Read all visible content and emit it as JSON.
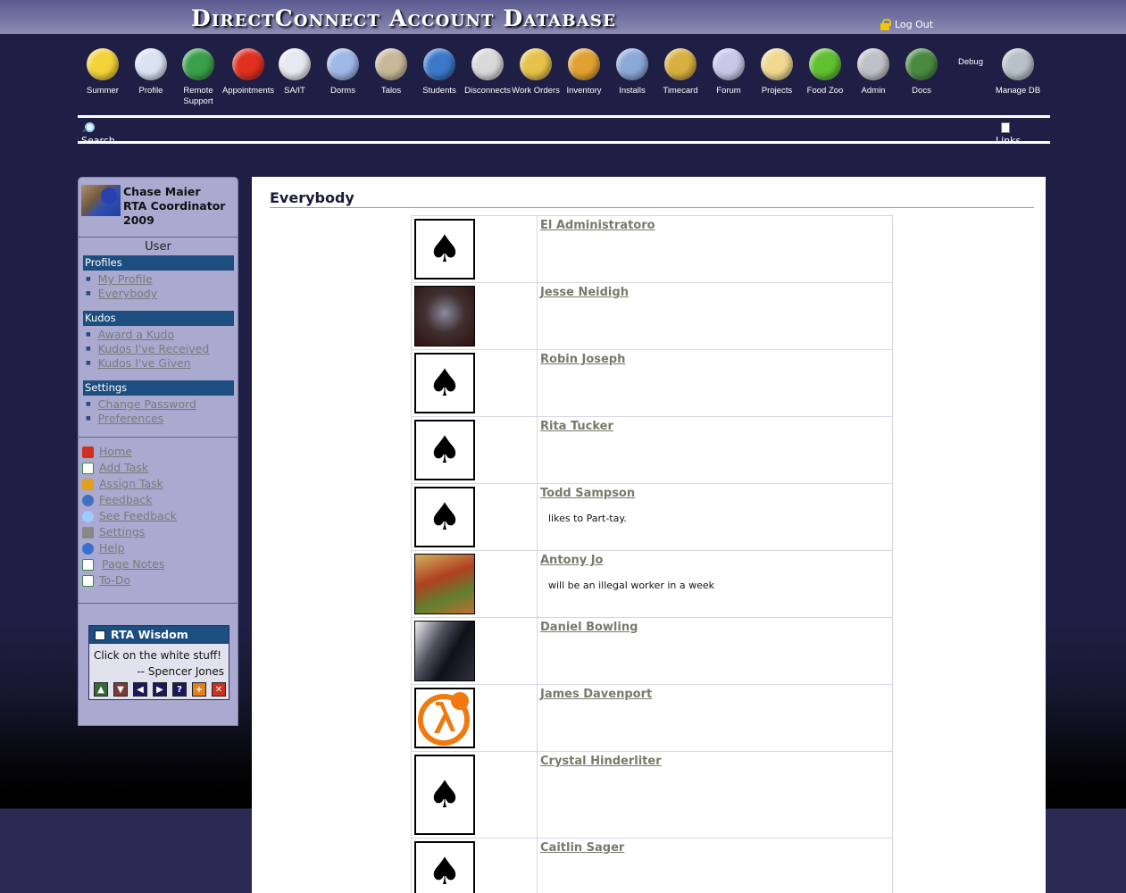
{
  "header": {
    "title": "DirectConnect Account Database",
    "logout_label": "Log Out"
  },
  "nav": [
    {
      "label": "Summer",
      "icon": "sunglasses-face-icon",
      "color": "#f4d23a"
    },
    {
      "label": "Profile",
      "icon": "profile-card-icon",
      "color": "#d9e3f2"
    },
    {
      "label": "Remote Support",
      "icon": "globe-question-icon",
      "color": "#3aa04a"
    },
    {
      "label": "Appointments",
      "icon": "alarm-clock-icon",
      "color": "#e03020"
    },
    {
      "label": "SA/IT",
      "icon": "medical-cross-icon",
      "color": "#e8e8f0"
    },
    {
      "label": "Dorms",
      "icon": "building-icon",
      "color": "#9fb8e6"
    },
    {
      "label": "Talos",
      "icon": "skull-icon",
      "color": "#c8b89a"
    },
    {
      "label": "Students",
      "icon": "student-person-icon",
      "color": "#3b78c8"
    },
    {
      "label": "Disconnects",
      "icon": "unplugged-cable-icon",
      "color": "#d9d9d9"
    },
    {
      "label": "Work Orders",
      "icon": "clipboard-pin-icon",
      "color": "#e6c24a"
    },
    {
      "label": "Inventory",
      "icon": "box-icon",
      "color": "#e2a232"
    },
    {
      "label": "Installs",
      "icon": "install-disc-icon",
      "color": "#8aa8d8"
    },
    {
      "label": "Timecard",
      "icon": "money-bag-icon",
      "color": "#d8b040"
    },
    {
      "label": "Forum",
      "icon": "speech-bubble-icon",
      "color": "#c8c8e8"
    },
    {
      "label": "Projects",
      "icon": "folder-icon",
      "color": "#f0d890"
    },
    {
      "label": "Food Zoo",
      "icon": "apple-icon",
      "color": "#60c030"
    },
    {
      "label": "Admin",
      "icon": "gears-icon",
      "color": "#c0c0c8"
    },
    {
      "label": "Docs",
      "icon": "books-icon",
      "color": "#4a8a40"
    },
    {
      "label": "Debug",
      "icon": "",
      "color": ""
    },
    {
      "label": "Manage DB",
      "icon": "database-check-icon",
      "color": "#b8c0c8"
    }
  ],
  "subnav": {
    "search_label": "Search",
    "links_label": "Links"
  },
  "sidebar": {
    "profile": {
      "line1": "Chase Maier",
      "line2": "RTA Coordinator",
      "line3": "2009"
    },
    "heading": "User",
    "sections": [
      {
        "title": "Profiles",
        "items": [
          "My Profile",
          "Everybody"
        ]
      },
      {
        "title": "Kudos",
        "items": [
          "Award a Kudo",
          "Kudos I've Received",
          "Kudos I've Given"
        ]
      },
      {
        "title": "Settings",
        "items": [
          "Change Password",
          "Preferences"
        ]
      }
    ],
    "actions": [
      {
        "label": "Home",
        "icon": "home-icon"
      },
      {
        "label": "Add Task",
        "icon": "checkbox-icon"
      },
      {
        "label": "Assign Task",
        "icon": "assign-person-icon"
      },
      {
        "label": "Feedback",
        "icon": "info-icon"
      },
      {
        "label": "See Feedback",
        "icon": "magnifier-icon"
      },
      {
        "label": "Settings",
        "icon": "tools-icon"
      },
      {
        "label": "Help",
        "icon": "help-icon"
      },
      {
        "label": "Page Notes",
        "icon": "note-pencil-icon"
      },
      {
        "label": "To-Do",
        "icon": "todo-pencil-icon"
      }
    ],
    "wisdom": {
      "title": "RTA Wisdom",
      "quote": "Click on the white stuff!",
      "author": "-- Spencer Jones"
    }
  },
  "main": {
    "title": "Everybody",
    "people": [
      {
        "name": "El Administratoro",
        "note": "",
        "picture": "spade-card"
      },
      {
        "name": "Jesse Neidigh",
        "note": "",
        "picture": "photo"
      },
      {
        "name": "Robin Joseph",
        "note": "",
        "picture": "spade-card"
      },
      {
        "name": "Rita Tucker",
        "note": "",
        "picture": "spade-card"
      },
      {
        "name": "Todd Sampson",
        "note": "likes to Part-tay.",
        "picture": "spade-card"
      },
      {
        "name": "Antony Jo",
        "note": "will be an illegal worker in a week",
        "picture": "photo"
      },
      {
        "name": "Daniel Bowling",
        "note": "",
        "picture": "photo"
      },
      {
        "name": "James Davenport",
        "note": "",
        "picture": "half-life-logo"
      },
      {
        "name": "Crystal Hinderliter",
        "note": "",
        "picture": "spade-card"
      },
      {
        "name": "Caitlin Sager",
        "note": "",
        "picture": "spade-card"
      }
    ]
  }
}
